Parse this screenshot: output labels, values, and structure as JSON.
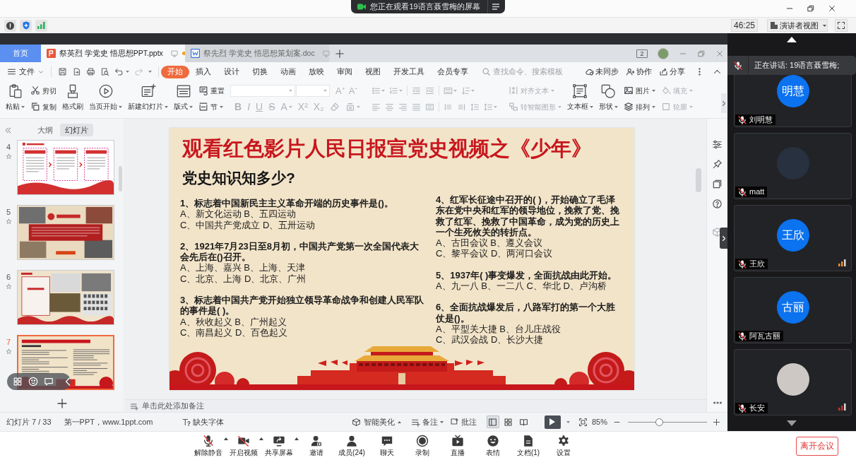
{
  "share_banner": {
    "text": "您正在观看19语言聂雪梅的屏幕"
  },
  "meeting_info": {
    "timer": "46:25",
    "view_mode": "演讲者视图"
  },
  "doc_tabs": [
    {
      "label": "首页",
      "kind": "home",
      "selected": false
    },
    {
      "label": "祭英烈 学党史 悟思想PPT.pptx",
      "kind": "slides",
      "selected": true,
      "unsaved": true
    },
    {
      "label": "祭先烈 学党史 悟思想策划案.doc",
      "kind": "document",
      "selected": false,
      "unsaved": false
    }
  ],
  "window_count": "2",
  "menu": {
    "file": "文件",
    "tabs": [
      {
        "label": "开始",
        "selected": true
      },
      {
        "label": "插入",
        "selected": false
      },
      {
        "label": "设计",
        "selected": false
      },
      {
        "label": "切换",
        "selected": false
      },
      {
        "label": "动画",
        "selected": false
      },
      {
        "label": "放映",
        "selected": false
      },
      {
        "label": "审阅",
        "selected": false
      },
      {
        "label": "视图",
        "selected": false
      },
      {
        "label": "开发工具",
        "selected": false
      },
      {
        "label": "会员专享",
        "selected": false
      }
    ],
    "search": {
      "placeholder": "查找命令、搜索模板"
    },
    "actions": [
      "未同步",
      "协作",
      "分享"
    ]
  },
  "ribbon": {
    "left_items": [
      {
        "label": "粘贴",
        "kind": "large",
        "dropdown": true,
        "disabled": false
      },
      {
        "label": "剪切",
        "kind": "small",
        "dropdown": false,
        "disabled": false
      },
      {
        "label": "复制",
        "kind": "small",
        "dropdown": false,
        "disabled": false
      },
      {
        "label": "格式刷",
        "kind": "large",
        "dropdown": false,
        "disabled": false
      },
      {
        "label": "当页开始",
        "kind": "large",
        "dropdown": true,
        "disabled": false
      },
      {
        "label": "新建幻灯片",
        "kind": "large",
        "dropdown": true,
        "disabled": false
      },
      {
        "label": "版式",
        "kind": "large",
        "dropdown": true,
        "disabled": false
      },
      {
        "label": "重置",
        "kind": "small",
        "dropdown": false,
        "disabled": false
      },
      {
        "label": "节",
        "kind": "small",
        "dropdown": true,
        "disabled": false
      }
    ],
    "font_tools": {
      "disabled": true,
      "size_buttons": [
        "A⁺",
        "A⁻"
      ],
      "style_buttons": [
        "B",
        "I",
        "U",
        "S",
        "A",
        "X²",
        "X₂"
      ]
    },
    "paragraph_tools": {
      "disabled": true
    },
    "right_items": [
      {
        "label": "对齐文本",
        "kind": "small",
        "dropdown": true,
        "disabled": true
      },
      {
        "label": "转智能图形",
        "kind": "small",
        "dropdown": true,
        "disabled": true
      },
      {
        "label": "文本框",
        "kind": "large",
        "dropdown": true,
        "disabled": false
      },
      {
        "label": "形状",
        "kind": "large",
        "dropdown": true,
        "disabled": false
      },
      {
        "label": "图片",
        "kind": "small",
        "dropdown": true,
        "disabled": false
      },
      {
        "label": "排列",
        "kind": "small",
        "dropdown": true,
        "disabled": false
      },
      {
        "label": "填充",
        "kind": "small",
        "dropdown": true,
        "disabled": true
      },
      {
        "label": "轮廓",
        "kind": "small",
        "dropdown": true,
        "disabled": true
      }
    ]
  },
  "panel_tabs": [
    {
      "label": "大纲",
      "selected": false
    },
    {
      "label": "幻灯片",
      "selected": true
    }
  ],
  "thumbnails": [
    {
      "number": "4",
      "selected": false
    },
    {
      "number": "5",
      "selected": false
    },
    {
      "number": "6",
      "selected": false
    },
    {
      "number": "7",
      "selected": true
    }
  ],
  "slide": {
    "title": "观看红色影片人民日报宣党史视频之《少年》",
    "subtitle": "党史知识知多少?",
    "columns": [
      [
        {
          "question": "1、标志着中国新民主主义革命开端的历史事件是()。",
          "options": [
            "A、新文化运动 B、五四运动",
            "C、中国共产党成立 D、五卅运动"
          ]
        },
        {
          "question": "2、1921年7月23日至8月初，中国共产党第一次全国代表大会先后在()召开。",
          "options": [
            "A、上海、嘉兴 B、上海、天津",
            "C、北京、上海 D、北京、广州"
          ]
        },
        {
          "question": "3、标志着中国共产党开始独立领导革命战争和创建人民军队的事件是( )。",
          "options": [
            "A、秋收起义 B、广州起义",
            "C、南昌起义 D、百色起义"
          ]
        }
      ],
      [
        {
          "question": "4、红军长征途中召开的( )，开始确立了毛泽东在党中央和红军的领导地位，挽救了党、挽救了红军、挽救了中国革命，成为党的历史上一个生死攸关的转折点。",
          "options": [
            "A、古田会议 B、遵义会议",
            "C、黎平会议 D、两河口会议"
          ]
        },
        {
          "question": "5、1937年( )事变爆发，全面抗战由此开始。",
          "options": [
            "A、九一八 B、一二八 C、华北 D、卢沟桥"
          ]
        },
        {
          "question": "6、全面抗战爆发后，八路军打的第一个大胜仗是()。",
          "options": [
            "A、平型关大捷 B、台儿庄战役",
            "C、武汉会战 D、长沙大捷"
          ]
        }
      ]
    ]
  },
  "notes": {
    "placeholder": "单击此处添加备注"
  },
  "status_bar": {
    "slide_counter": "幻灯片 7 / 33",
    "template": "第一PPT，www.1ppt.com",
    "missing_fonts": "缺失字体",
    "beautify": "智能美化",
    "notes": "备注",
    "comments": "批注",
    "views": [
      {
        "selected": true
      },
      {
        "selected": false
      },
      {
        "selected": false
      }
    ],
    "zoom": "85%",
    "zoom_slider": {
      "level": 0.4
    }
  },
  "speaking": {
    "text": "正在讲话: 19语言聂雪梅;"
  },
  "participants": [
    {
      "name": "刘明慧",
      "kind": "initials",
      "avatar_text": "明慧",
      "muted": true
    },
    {
      "name": "matt",
      "kind": "photo",
      "muted": true
    },
    {
      "name": "王欣",
      "kind": "initials",
      "avatar_text": "王欣",
      "muted": true,
      "signal": {
        "color": "#f28c28"
      }
    },
    {
      "name": "阿瓦古丽",
      "kind": "initials",
      "avatar_text": "古丽",
      "muted": true
    },
    {
      "name": "长安",
      "kind": "photo",
      "muted": true,
      "signal": {
        "color": "#c8322a"
      }
    }
  ],
  "toolbar": [
    {
      "label": "解除静音",
      "menu": true
    },
    {
      "label": "开启视频",
      "menu": true
    },
    {
      "label": "共享屏幕",
      "menu": true
    },
    {
      "label": "邀请",
      "menu": false
    },
    {
      "label": "成员(24)",
      "menu": false
    },
    {
      "label": "聊天",
      "menu": false
    },
    {
      "label": "录制",
      "menu": false
    },
    {
      "label": "直播",
      "menu": false
    },
    {
      "label": "表情",
      "menu": false
    },
    {
      "label": "文档(1)",
      "menu": false
    },
    {
      "label": "设置",
      "menu": false
    }
  ],
  "leave_button": "离开会议"
}
